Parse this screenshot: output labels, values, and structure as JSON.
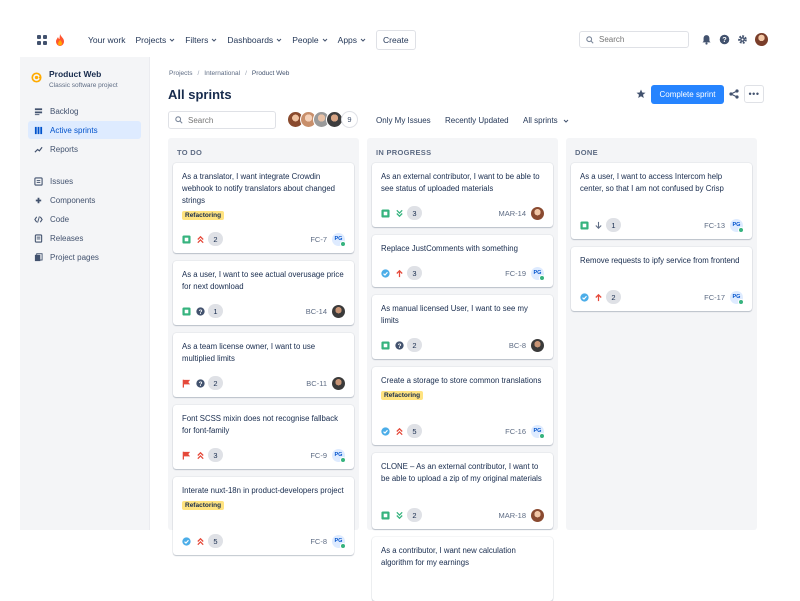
{
  "nav": {
    "items": [
      {
        "label": "Your work",
        "dropdown": false
      },
      {
        "label": "Projects",
        "dropdown": true
      },
      {
        "label": "Filters",
        "dropdown": true
      },
      {
        "label": "Dashboards",
        "dropdown": true
      },
      {
        "label": "People",
        "dropdown": true
      },
      {
        "label": "Apps",
        "dropdown": true
      }
    ],
    "create_label": "Create",
    "search_placeholder": "Search"
  },
  "sidebar": {
    "project_name": "Product Web",
    "project_type": "Classic software project",
    "items": [
      {
        "label": "Backlog",
        "icon": "backlog-icon",
        "active": false
      },
      {
        "label": "Active sprints",
        "icon": "board-icon",
        "active": true
      },
      {
        "label": "Reports",
        "icon": "reports-icon",
        "active": false
      },
      {
        "label": "Issues",
        "icon": "issues-icon",
        "active": false
      },
      {
        "label": "Components",
        "icon": "components-icon",
        "active": false
      },
      {
        "label": "Code",
        "icon": "code-icon",
        "active": false
      },
      {
        "label": "Releases",
        "icon": "releases-icon",
        "active": false
      },
      {
        "label": "Project pages",
        "icon": "pages-icon",
        "active": false
      }
    ]
  },
  "breadcrumb": [
    "Projects",
    "International",
    "Product Web"
  ],
  "page": {
    "title": "All sprints",
    "complete_label": "Complete sprint",
    "more_label": "•••"
  },
  "toolbar": {
    "search_placeholder": "Search",
    "avatar_count": "9",
    "only_my_issues": "Only My Issues",
    "recently_updated": "Recently Updated",
    "all_sprints": "All sprints"
  },
  "colors": {
    "accent": "#2684ff",
    "story": "#36b37e",
    "bug": "#e5493a",
    "task": "#4bade8",
    "label": "#ffe380"
  },
  "columns": [
    {
      "title": "TO DO",
      "cards": [
        {
          "title": "As a translator, I want integrate Crowdin webhook to notify translators about changed strings",
          "label": "Refactoring",
          "type": "story",
          "priority": "highest",
          "points": "2",
          "key": "FC-7",
          "assignee": "PG"
        },
        {
          "title": "As a user, I want to see actual overusage price for next download",
          "label": "",
          "type": "story",
          "priority": "unknown",
          "points": "1",
          "key": "BC-14",
          "assignee": "man"
        },
        {
          "title": "As a team license owner, I want to use multiplied limits",
          "label": "",
          "type": "bug",
          "priority": "unknown",
          "points": "2",
          "key": "BC-11",
          "assignee": "man"
        },
        {
          "title": "Font SCSS mixin does not recognise fallback for font-family",
          "label": "",
          "type": "bug",
          "priority": "highest",
          "points": "3",
          "key": "FC-9",
          "assignee": "PG"
        },
        {
          "title": "Interate nuxt-18n in product-developers project",
          "label": "Refactoring",
          "type": "task",
          "priority": "highest",
          "points": "5",
          "key": "FC-8",
          "assignee": "PG"
        }
      ]
    },
    {
      "title": "IN PROGRESS",
      "cards": [
        {
          "title": "As an external contributor, I want to be able to see status of uploaded materials",
          "label": "",
          "type": "story",
          "priority": "lowest",
          "points": "3",
          "key": "MAR-14",
          "assignee": "woman"
        },
        {
          "title": "Replace JustComments with something",
          "label": "",
          "type": "task",
          "priority": "high",
          "points": "3",
          "key": "FC-19",
          "assignee": "PG"
        },
        {
          "title": "As manual licensed User, I want to see my limits",
          "label": "",
          "type": "story",
          "priority": "unknown",
          "points": "2",
          "key": "BC-8",
          "assignee": "man"
        },
        {
          "title": "Create a storage to store common translations",
          "label": "Refactoring",
          "type": "task",
          "priority": "highest",
          "points": "5",
          "key": "FC-16",
          "assignee": "PG"
        },
        {
          "title": "CLONE – As an external contributor, I want to be able to upload a zip of my original materials",
          "label": "",
          "type": "story",
          "priority": "lowest",
          "points": "2",
          "key": "MAR-18",
          "assignee": "woman"
        },
        {
          "title": "As a contributor, I want new calculation algorithm for my earnings",
          "label": "",
          "type": "story",
          "priority": "",
          "points": "",
          "key": "",
          "assignee": ""
        }
      ]
    },
    {
      "title": "DONE",
      "cards": [
        {
          "title": "As a user, I want to access Intercom help center, so that I am not confused by Crisp",
          "label": "",
          "type": "story",
          "priority": "low",
          "points": "1",
          "key": "FC-13",
          "assignee": "PG"
        },
        {
          "title": "Remove requests to ipfy service from frontend",
          "label": "",
          "type": "task",
          "priority": "high",
          "points": "2",
          "key": "FC-17",
          "assignee": "PG"
        }
      ]
    }
  ]
}
